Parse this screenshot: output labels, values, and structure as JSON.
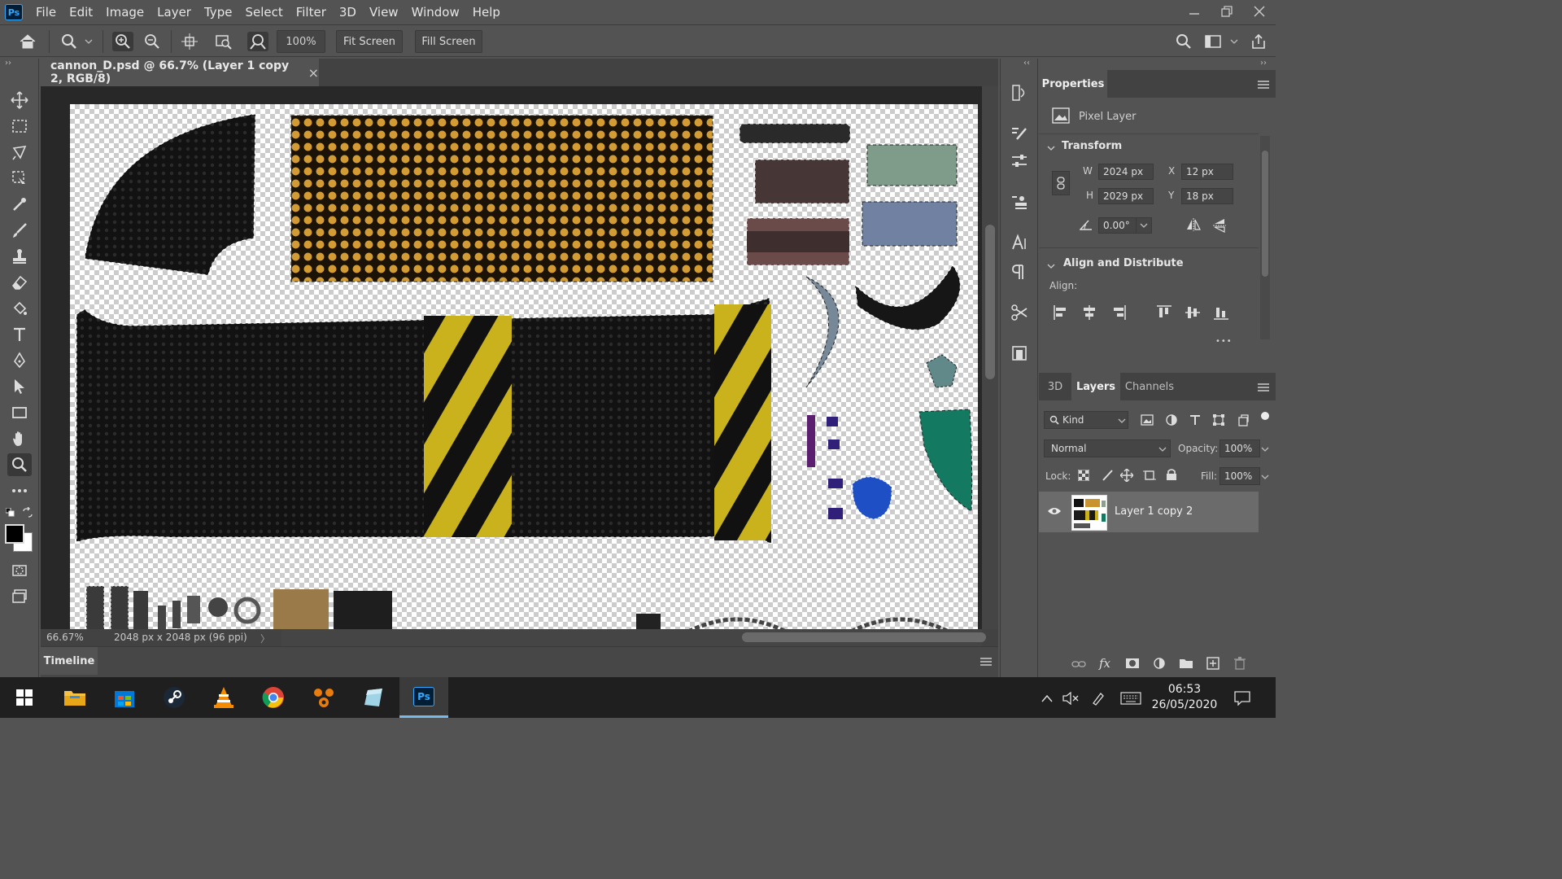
{
  "app": {
    "logo": "Ps"
  },
  "menu": [
    "File",
    "Edit",
    "Image",
    "Layer",
    "Type",
    "Select",
    "Filter",
    "3D",
    "View",
    "Window",
    "Help"
  ],
  "options": {
    "zoom_value": "100%",
    "fit_screen": "Fit Screen",
    "fill_screen": "Fill Screen"
  },
  "document": {
    "tab_title": "cannon_D.psd @ 66.7% (Layer 1 copy 2, RGB/8)",
    "close_glyph": "×",
    "zoom_readout": "66.67%",
    "doc_info": "2048 px x 2048 px (96 ppi)",
    "info_arrow": "〉"
  },
  "timeline": {
    "label": "Timeline"
  },
  "properties": {
    "tab": "Properties",
    "layer_kind": "Pixel Layer",
    "transform_title": "Transform",
    "w_label": "W",
    "w_value": "2024 px",
    "h_label": "H",
    "h_value": "2029 px",
    "x_label": "X",
    "x_value": "12 px",
    "y_label": "Y",
    "y_value": "18 px",
    "angle_value": "0.00°",
    "align_title": "Align and Distribute",
    "align_label": "Align:",
    "more": "•••"
  },
  "layers_panel": {
    "tabs": [
      "3D",
      "Layers",
      "Channels"
    ],
    "kind_filter": "Kind",
    "blend_mode": "Normal",
    "opacity_label": "Opacity:",
    "opacity_value": "100%",
    "lock_label": "Lock:",
    "fill_label": "Fill:",
    "fill_value": "100%",
    "layers": [
      {
        "name": "Layer 1 copy 2",
        "visible": true,
        "selected": true
      }
    ]
  },
  "taskbar": {
    "time": "06:53",
    "date": "26/05/2020",
    "apps": [
      "windows-start",
      "file-explorer",
      "store",
      "steam",
      "vlc",
      "chrome",
      "blender",
      "notes",
      "photoshop"
    ]
  },
  "colors": {
    "accent": "#31a8ff",
    "panel_bg": "#535353",
    "canvas_border": "#282828"
  }
}
